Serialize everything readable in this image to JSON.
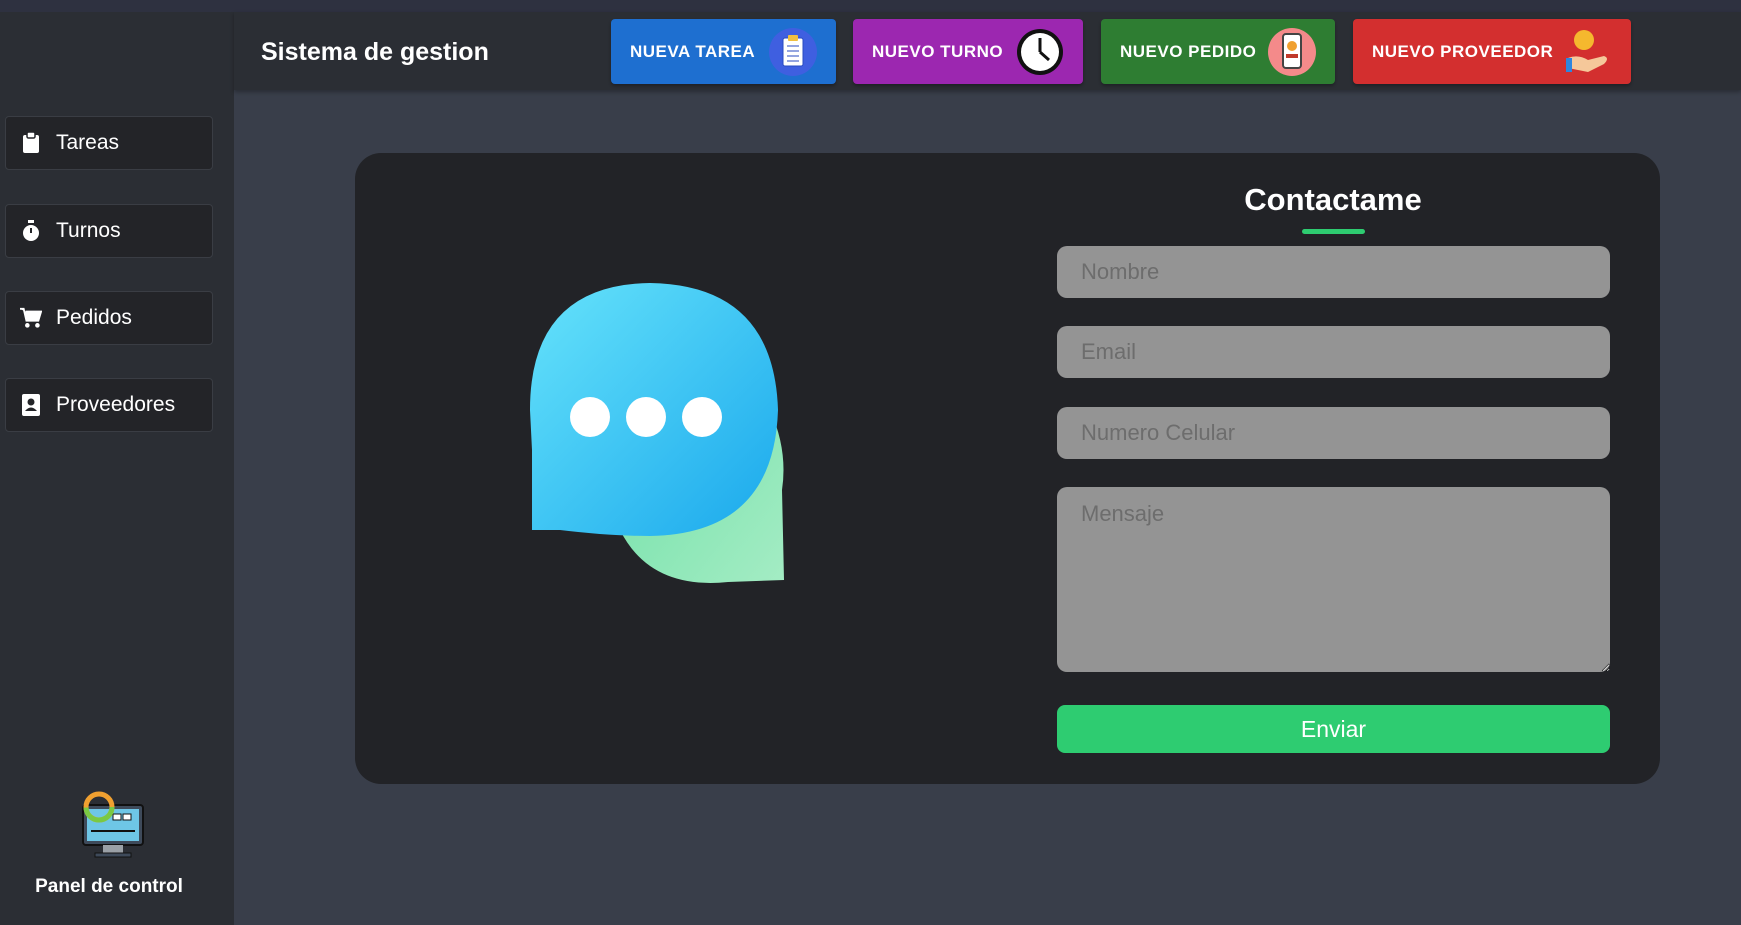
{
  "header": {
    "brand": "Sistema de gestion",
    "buttons": [
      {
        "label": "NUEVA TAREA",
        "color": "#1e6fd0",
        "icon": "clipboard-icon"
      },
      {
        "label": "NUEVO TURNO",
        "color": "#9c27b0",
        "icon": "clock-icon"
      },
      {
        "label": "NUEVO PEDIDO",
        "color": "#2e7d32",
        "icon": "phone-order-icon"
      },
      {
        "label": "NUEVO PROVEEDOR",
        "color": "#d32f2f",
        "icon": "hand-money-icon"
      }
    ]
  },
  "sidebar": {
    "items": [
      {
        "label": "Tareas",
        "icon": "clipboard-icon"
      },
      {
        "label": "Turnos",
        "icon": "stopwatch-icon"
      },
      {
        "label": "Pedidos",
        "icon": "cart-icon"
      },
      {
        "label": "Proveedores",
        "icon": "contact-book-icon"
      }
    ],
    "panel_label": "Panel de control"
  },
  "contact": {
    "title": "Contactame",
    "name_placeholder": "Nombre",
    "email_placeholder": "Email",
    "phone_placeholder": "Numero Celular",
    "message_placeholder": "Mensaje",
    "submit_label": "Enviar",
    "accent": "#2ecc71"
  }
}
